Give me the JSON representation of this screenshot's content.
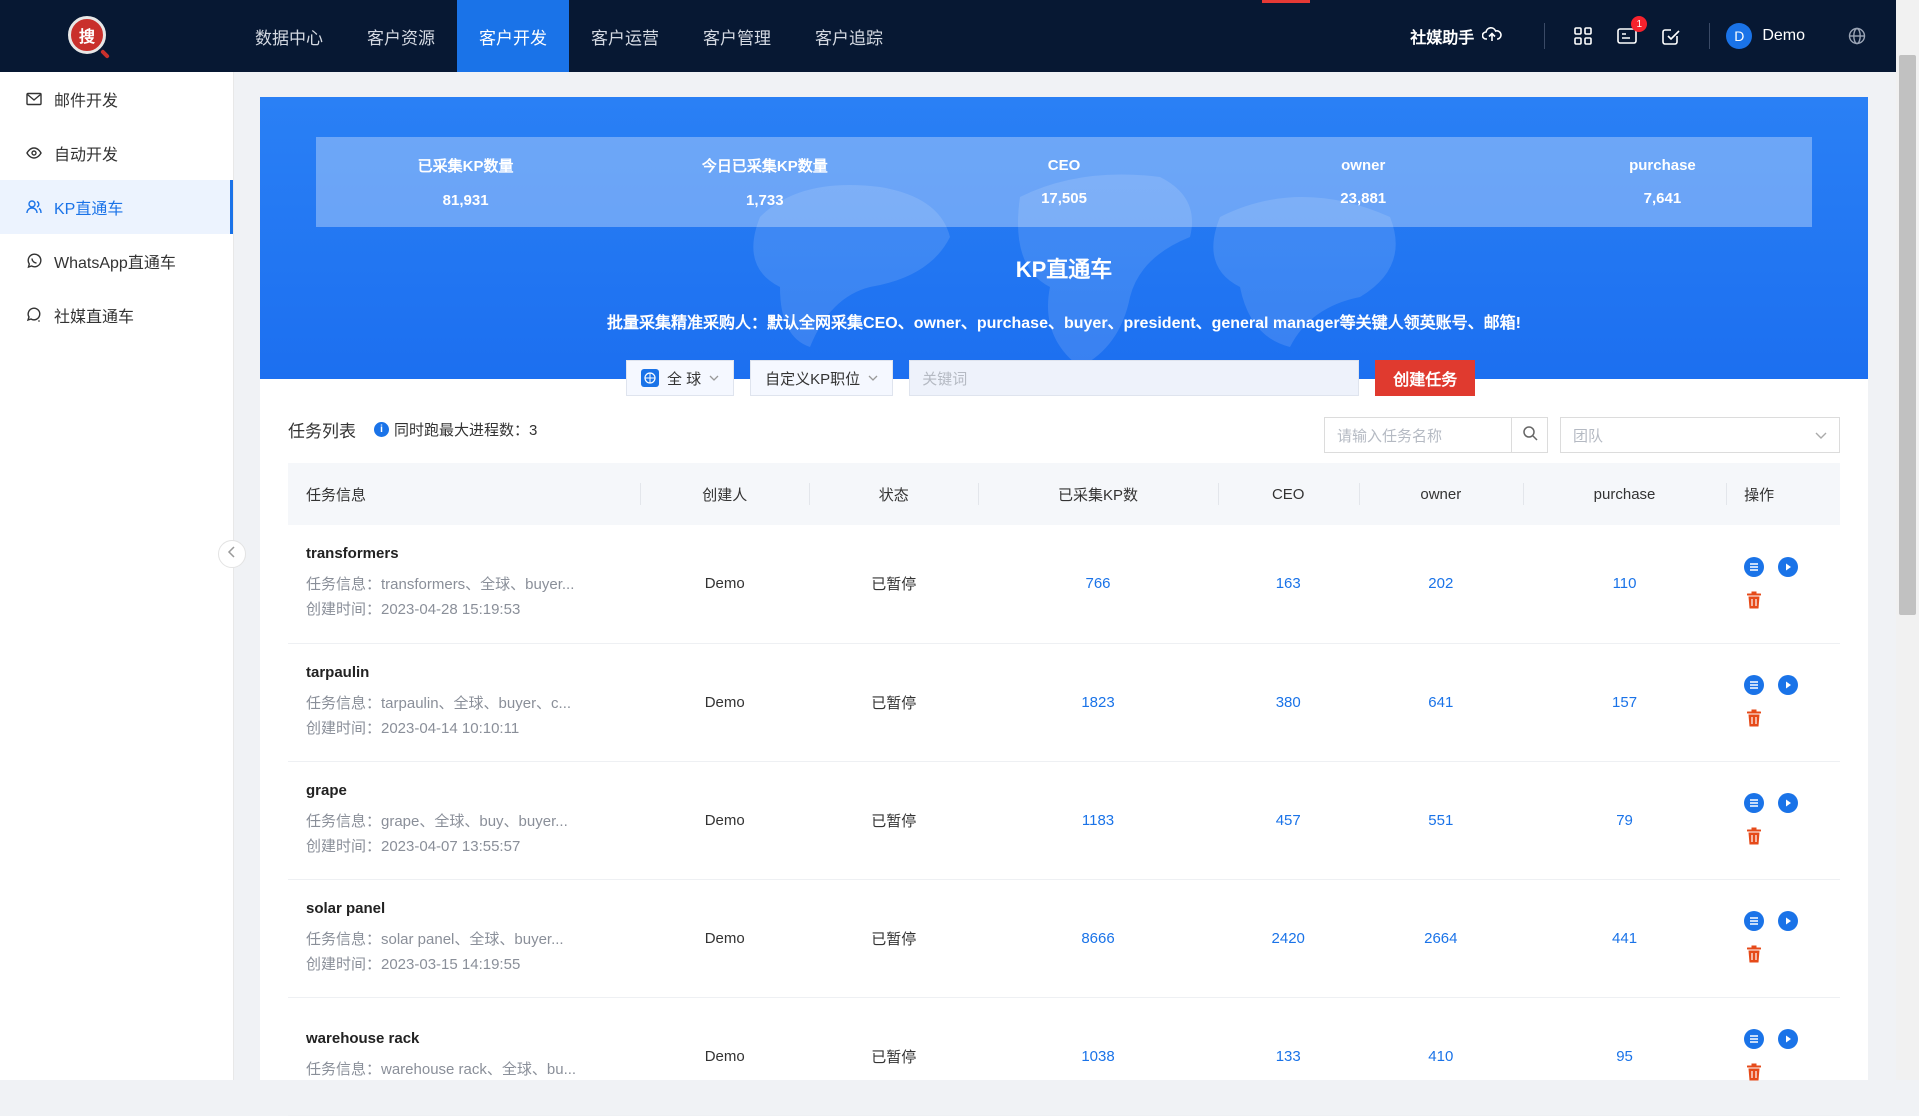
{
  "nav": {
    "items": [
      "数据中心",
      "客户资源",
      "客户开发",
      "客户运营",
      "客户管理",
      "客户追踪"
    ],
    "active_index": 2
  },
  "topright": {
    "helper_label": "社媒助手",
    "badge_count": "1",
    "avatar_letter": "D",
    "user_name": "Demo"
  },
  "sidebar": {
    "items": [
      {
        "label": "邮件开发",
        "icon": "mail-icon"
      },
      {
        "label": "自动开发",
        "icon": "eye-icon"
      },
      {
        "label": "KP直通车",
        "icon": "users-icon"
      },
      {
        "label": "WhatsApp直通车",
        "icon": "whatsapp-icon"
      },
      {
        "label": "社媒直通车",
        "icon": "chat-icon"
      }
    ],
    "active_index": 2
  },
  "banner": {
    "stats": [
      {
        "label": "已采集KP数量",
        "value": "81,931"
      },
      {
        "label": "今日已采集KP数量",
        "value": "1,733"
      },
      {
        "label": "CEO",
        "value": "17,505"
      },
      {
        "label": "owner",
        "value": "23,881"
      },
      {
        "label": "purchase",
        "value": "7,641"
      }
    ],
    "title": "KP直通车",
    "subtitle": "批量采集精准采购人：默认全网采集CEO、owner、purchase、buyer、president、general manager等关键人领英账号、邮箱!"
  },
  "search": {
    "region": "全 球",
    "position": "自定义KP职位",
    "keyword_placeholder": "关键词",
    "create_label": "创建任务"
  },
  "list": {
    "title": "任务列表",
    "note": "同时跑最大进程数：3",
    "task_search_placeholder": "请输入任务名称",
    "team_placeholder": "团队",
    "columns": [
      "任务信息",
      "创建人",
      "状态",
      "已采集KP数",
      "CEO",
      "owner",
      "purchase",
      "操作"
    ],
    "rows": [
      {
        "name": "transformers",
        "desc": "任务信息：transformers、全球、buyer...",
        "time": "创建时间：2023-04-28 15:19:53",
        "creator": "Demo",
        "status": "已暂停",
        "kp": "766",
        "ceo": "163",
        "owner": "202",
        "purchase": "110"
      },
      {
        "name": "tarpaulin",
        "desc": "任务信息：tarpaulin、全球、buyer、c...",
        "time": "创建时间：2023-04-14 10:10:11",
        "creator": "Demo",
        "status": "已暂停",
        "kp": "1823",
        "ceo": "380",
        "owner": "641",
        "purchase": "157"
      },
      {
        "name": "grape",
        "desc": "任务信息：grape、全球、buy、buyer...",
        "time": "创建时间：2023-04-07 13:55:57",
        "creator": "Demo",
        "status": "已暂停",
        "kp": "1183",
        "ceo": "457",
        "owner": "551",
        "purchase": "79"
      },
      {
        "name": "solar panel",
        "desc": "任务信息：solar panel、全球、buyer...",
        "time": "创建时间：2023-03-15 14:19:55",
        "creator": "Demo",
        "status": "已暂停",
        "kp": "8666",
        "ceo": "2420",
        "owner": "2664",
        "purchase": "441"
      },
      {
        "name": "warehouse rack",
        "desc": "任务信息：warehouse rack、全球、bu...",
        "time": "",
        "creator": "Demo",
        "status": "已暂停",
        "kp": "1038",
        "ceo": "133",
        "owner": "410",
        "purchase": "95"
      }
    ]
  }
}
